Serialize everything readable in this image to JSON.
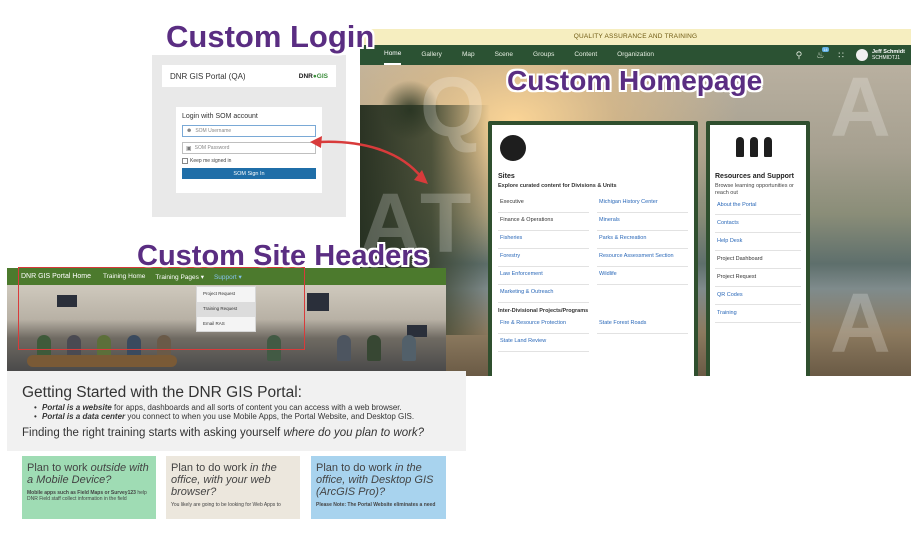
{
  "overlay_labels": {
    "login": "Custom Login",
    "homepage": "Custom Homepage",
    "headers": "Custom Site Headers"
  },
  "homepage": {
    "banner": "QUALITY ASSURANCE AND TRAINING",
    "nav": [
      "Home",
      "Gallery",
      "Map",
      "Scene",
      "Groups",
      "Content",
      "Organization"
    ],
    "notification_count": "14",
    "user_name": "Jeff Schmidt",
    "user_id": "SCHMIDTJ1",
    "icons": [
      "search-icon",
      "bell-icon",
      "apps-grid-icon"
    ],
    "sites": {
      "title": "Sites",
      "subtitle": "Explore curated content for Divisions & Units",
      "col1": [
        "Executive",
        "Finance & Operations",
        "Fisheries",
        "Forestry",
        "Law Enforcement",
        "Marketing & Outreach"
      ],
      "col2": [
        "Michigan History Center",
        "Minerals",
        "Parks & Recreation",
        "Resource Assessment Section",
        "Wildlife"
      ],
      "inter_title": "Inter-Divisional Projects/Programs",
      "inter_col1": [
        "Fire & Resource Protection",
        "State Land Review"
      ],
      "inter_col2": [
        "State Forest Roads"
      ]
    },
    "resources": {
      "title": "Resources and Support",
      "subtitle": "Browse learning opportunities or reach out",
      "links": [
        "About the Portal",
        "Contacts",
        "Help Desk",
        "Project Dashboard",
        "Project Request",
        "QR Codes",
        "Training"
      ]
    }
  },
  "login": {
    "portal_title": "DNR GIS Portal (QA)",
    "logo_text": "DNR",
    "logo_gis": "GIS",
    "login_with": "Login with SOM account",
    "username_placeholder": "SOM Username",
    "password_placeholder": "SOM Password",
    "keep_signed_in": "Keep me signed in",
    "sign_in": "SOM Sign In"
  },
  "site_header": {
    "brand": "DNR GIS Portal Home",
    "items": [
      "Training Home",
      "Training Pages ▾",
      "Support ▾"
    ],
    "dropdown": [
      "Project Request",
      "Training Request",
      "Email RAS"
    ]
  },
  "getting_started": {
    "title": "Getting Started with the DNR GIS Portal:",
    "bullet1_em": "Portal is a website",
    "bullet1_rest": " for apps, dashboards and all sorts of content you can access with a web browser.",
    "bullet2_em": "Portal is a data center",
    "bullet2_rest": " you connect to when you use Mobile Apps, the Portal Website, and Desktop GIS.",
    "question_lead": "Finding the right training starts with asking yourself ",
    "question_em": "where do you plan to work?"
  },
  "plans": [
    {
      "lead": "Plan to work ",
      "em": "outside with a Mobile Device?",
      "desc_bold": "Mobile apps such as Field Maps or Survey123",
      "desc": " help DNR Field staff collect information in the field"
    },
    {
      "lead": "Plan to do work ",
      "em": "in the office, with your web browser?",
      "desc_bold": "",
      "desc": "You likely are going to be looking for Web Apps to"
    },
    {
      "lead": "Plan to do work ",
      "em": "in the office, with Desktop GIS (ArcGIS Pro)?",
      "desc_bold": "Please Note: The Portal Website eliminates a need",
      "desc": ""
    }
  ],
  "colors": {
    "nav_green": "#2b5233",
    "site_header_green": "#4c7a2d",
    "label_purple": "#5a2d82",
    "highlight_red": "#d83b3b",
    "link_blue": "#2a68b8"
  }
}
